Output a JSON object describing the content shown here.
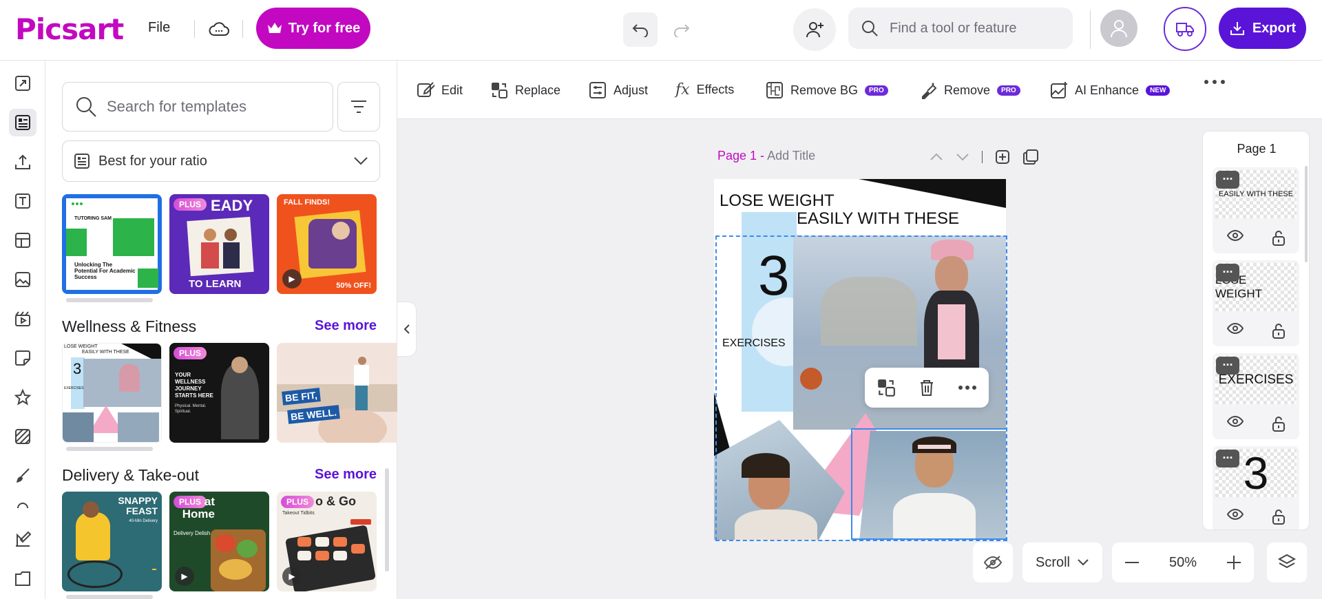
{
  "app": {
    "logo": "Picsart",
    "file_menu": "File",
    "try_button": "Try for free",
    "search_placeholder": "Find a tool or feature",
    "export_button": "Export"
  },
  "left_panel": {
    "search_placeholder": "Search for templates",
    "ratio_select": "Best for your ratio",
    "top_thumbs": [
      {
        "text": "TUTORING SAM",
        "subtext": "Unlocking The Potential For Academic Success"
      },
      {
        "badge": "PLUS",
        "text": "EADY",
        "subtext": "TO LEARN"
      },
      {
        "text": "FALL FINDS!",
        "subtext": "50% OFF!"
      }
    ],
    "sections": [
      {
        "title": "Wellness & Fitness",
        "see_more": "See more",
        "thumbs": [
          {
            "text": "LOSE WEIGHT",
            "subtext": "EASILY WITH THESE",
            "number": "3",
            "caption": "EXERCISES"
          },
          {
            "badge": "PLUS",
            "text": "YOUR WELLNESS JOURNEY STARTS HERE",
            "subtext": "Physical. Mental. Spiritual."
          },
          {
            "text": "BE FIT,",
            "subtext": "BE WELL."
          }
        ]
      },
      {
        "title": "Delivery & Take-out",
        "see_more": "See more",
        "thumbs": [
          {
            "text": "SNAPPY FEAST",
            "subtext": "40-Min Delivery"
          },
          {
            "badge": "PLUS",
            "text": "at Home",
            "subtext": "Delivery Delish"
          },
          {
            "badge": "PLUS",
            "text": "o & Go",
            "subtext": "Takeout Tidbits"
          }
        ]
      }
    ]
  },
  "toolbar": {
    "tools": [
      {
        "label": "Edit",
        "icon": "edit-icon"
      },
      {
        "label": "Replace",
        "icon": "replace-icon"
      },
      {
        "label": "Adjust",
        "icon": "adjust-icon"
      },
      {
        "label": "Effects",
        "icon": "effects-icon"
      },
      {
        "label": "Remove BG",
        "icon": "remove-bg-icon",
        "badge": "PRO"
      },
      {
        "label": "Remove",
        "icon": "remove-icon",
        "badge": "PRO"
      },
      {
        "label": "AI Enhance",
        "icon": "ai-enhance-icon",
        "badge": "NEW"
      }
    ]
  },
  "canvas": {
    "page_label": "Page 1 -",
    "add_title": "Add Title",
    "headline_1": "LOSE WEIGHT",
    "headline_2": "EASILY WITH THESE",
    "number": "3",
    "caption": "EXERCISES"
  },
  "layers": {
    "title": "Page 1",
    "items": [
      {
        "preview_text": "EASILY WITH THESE"
      },
      {
        "preview_text": "LOSE WEIGHT"
      },
      {
        "preview_text": "EXERCISES"
      },
      {
        "preview_text": "3"
      }
    ]
  },
  "bottom": {
    "mode": "Scroll",
    "zoom": "50%"
  },
  "colors": {
    "brand": "#c209c1",
    "accent": "#5a14d8",
    "selection": "#3a8bea"
  }
}
